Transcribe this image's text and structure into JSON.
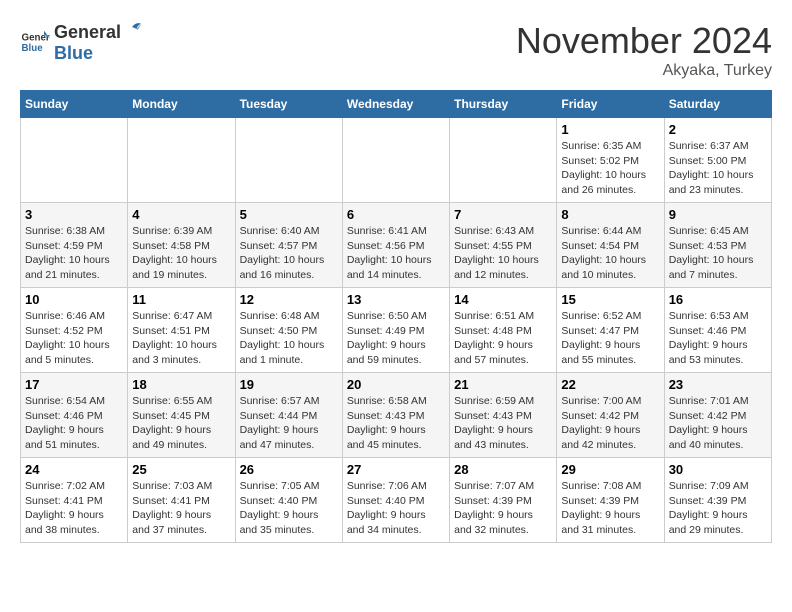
{
  "logo": {
    "text_general": "General",
    "text_blue": "Blue"
  },
  "header": {
    "month": "November 2024",
    "location": "Akyaka, Turkey"
  },
  "weekdays": [
    "Sunday",
    "Monday",
    "Tuesday",
    "Wednesday",
    "Thursday",
    "Friday",
    "Saturday"
  ],
  "weeks": [
    [
      {
        "day": "",
        "info": ""
      },
      {
        "day": "",
        "info": ""
      },
      {
        "day": "",
        "info": ""
      },
      {
        "day": "",
        "info": ""
      },
      {
        "day": "",
        "info": ""
      },
      {
        "day": "1",
        "info": "Sunrise: 6:35 AM\nSunset: 5:02 PM\nDaylight: 10 hours and 26 minutes."
      },
      {
        "day": "2",
        "info": "Sunrise: 6:37 AM\nSunset: 5:00 PM\nDaylight: 10 hours and 23 minutes."
      }
    ],
    [
      {
        "day": "3",
        "info": "Sunrise: 6:38 AM\nSunset: 4:59 PM\nDaylight: 10 hours and 21 minutes."
      },
      {
        "day": "4",
        "info": "Sunrise: 6:39 AM\nSunset: 4:58 PM\nDaylight: 10 hours and 19 minutes."
      },
      {
        "day": "5",
        "info": "Sunrise: 6:40 AM\nSunset: 4:57 PM\nDaylight: 10 hours and 16 minutes."
      },
      {
        "day": "6",
        "info": "Sunrise: 6:41 AM\nSunset: 4:56 PM\nDaylight: 10 hours and 14 minutes."
      },
      {
        "day": "7",
        "info": "Sunrise: 6:43 AM\nSunset: 4:55 PM\nDaylight: 10 hours and 12 minutes."
      },
      {
        "day": "8",
        "info": "Sunrise: 6:44 AM\nSunset: 4:54 PM\nDaylight: 10 hours and 10 minutes."
      },
      {
        "day": "9",
        "info": "Sunrise: 6:45 AM\nSunset: 4:53 PM\nDaylight: 10 hours and 7 minutes."
      }
    ],
    [
      {
        "day": "10",
        "info": "Sunrise: 6:46 AM\nSunset: 4:52 PM\nDaylight: 10 hours and 5 minutes."
      },
      {
        "day": "11",
        "info": "Sunrise: 6:47 AM\nSunset: 4:51 PM\nDaylight: 10 hours and 3 minutes."
      },
      {
        "day": "12",
        "info": "Sunrise: 6:48 AM\nSunset: 4:50 PM\nDaylight: 10 hours and 1 minute."
      },
      {
        "day": "13",
        "info": "Sunrise: 6:50 AM\nSunset: 4:49 PM\nDaylight: 9 hours and 59 minutes."
      },
      {
        "day": "14",
        "info": "Sunrise: 6:51 AM\nSunset: 4:48 PM\nDaylight: 9 hours and 57 minutes."
      },
      {
        "day": "15",
        "info": "Sunrise: 6:52 AM\nSunset: 4:47 PM\nDaylight: 9 hours and 55 minutes."
      },
      {
        "day": "16",
        "info": "Sunrise: 6:53 AM\nSunset: 4:46 PM\nDaylight: 9 hours and 53 minutes."
      }
    ],
    [
      {
        "day": "17",
        "info": "Sunrise: 6:54 AM\nSunset: 4:46 PM\nDaylight: 9 hours and 51 minutes."
      },
      {
        "day": "18",
        "info": "Sunrise: 6:55 AM\nSunset: 4:45 PM\nDaylight: 9 hours and 49 minutes."
      },
      {
        "day": "19",
        "info": "Sunrise: 6:57 AM\nSunset: 4:44 PM\nDaylight: 9 hours and 47 minutes."
      },
      {
        "day": "20",
        "info": "Sunrise: 6:58 AM\nSunset: 4:43 PM\nDaylight: 9 hours and 45 minutes."
      },
      {
        "day": "21",
        "info": "Sunrise: 6:59 AM\nSunset: 4:43 PM\nDaylight: 9 hours and 43 minutes."
      },
      {
        "day": "22",
        "info": "Sunrise: 7:00 AM\nSunset: 4:42 PM\nDaylight: 9 hours and 42 minutes."
      },
      {
        "day": "23",
        "info": "Sunrise: 7:01 AM\nSunset: 4:42 PM\nDaylight: 9 hours and 40 minutes."
      }
    ],
    [
      {
        "day": "24",
        "info": "Sunrise: 7:02 AM\nSunset: 4:41 PM\nDaylight: 9 hours and 38 minutes."
      },
      {
        "day": "25",
        "info": "Sunrise: 7:03 AM\nSunset: 4:41 PM\nDaylight: 9 hours and 37 minutes."
      },
      {
        "day": "26",
        "info": "Sunrise: 7:05 AM\nSunset: 4:40 PM\nDaylight: 9 hours and 35 minutes."
      },
      {
        "day": "27",
        "info": "Sunrise: 7:06 AM\nSunset: 4:40 PM\nDaylight: 9 hours and 34 minutes."
      },
      {
        "day": "28",
        "info": "Sunrise: 7:07 AM\nSunset: 4:39 PM\nDaylight: 9 hours and 32 minutes."
      },
      {
        "day": "29",
        "info": "Sunrise: 7:08 AM\nSunset: 4:39 PM\nDaylight: 9 hours and 31 minutes."
      },
      {
        "day": "30",
        "info": "Sunrise: 7:09 AM\nSunset: 4:39 PM\nDaylight: 9 hours and 29 minutes."
      }
    ]
  ]
}
